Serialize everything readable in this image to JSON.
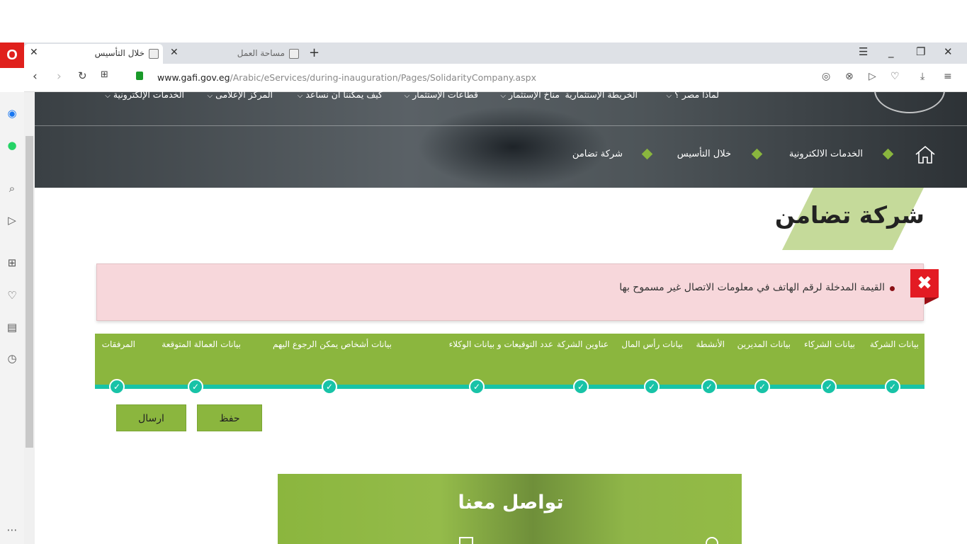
{
  "browser": {
    "tabs": [
      {
        "title": "خلال التأسيس",
        "active": true
      },
      {
        "title": "مساحة العمل",
        "active": false
      }
    ],
    "url_host": "www.gafi.gov.eg",
    "url_path": "/Arabic/eServices/during-inauguration/Pages/SolidarityCompany.aspx"
  },
  "site": {
    "topnav": [
      "لماذا مصر ؟",
      "الخريطة الإستثمارية",
      "مناخ الإستثمار",
      "قطاعات الإستثمار",
      "كيف يمكننا ان نساعد",
      "المركز الإعلامى",
      "الخدمات الإلكترونية"
    ],
    "breadcrumb": [
      "الخدمات الالكترونية",
      "خلال التأسيس",
      "شركة تضامن"
    ],
    "page_title": "شركة تضامن",
    "alert": {
      "message": "القيمة المدخلة لرقم الهاتف في معلومات الاتصال غير مسموح بها",
      "color": "#f7d7db"
    },
    "steps": [
      "بيانات الشركة",
      "بيانات الشركاء",
      "بيانات المديرين",
      "الأنشطة",
      "بيانات رأس المال",
      "عناوين الشركة",
      "عدد التوقيعات و بيانات الوكلاء",
      "بيانات أشخاص يمكن الرجوع اليهم",
      "بيانات العمالة المتوقعة",
      "المرفقات"
    ],
    "buttons": {
      "save": "حفظ",
      "submit": "ارسال"
    },
    "contact_title": "تواصل معنا",
    "accent_color": "#8bb63e",
    "step_line_color": "#18c3a7"
  }
}
